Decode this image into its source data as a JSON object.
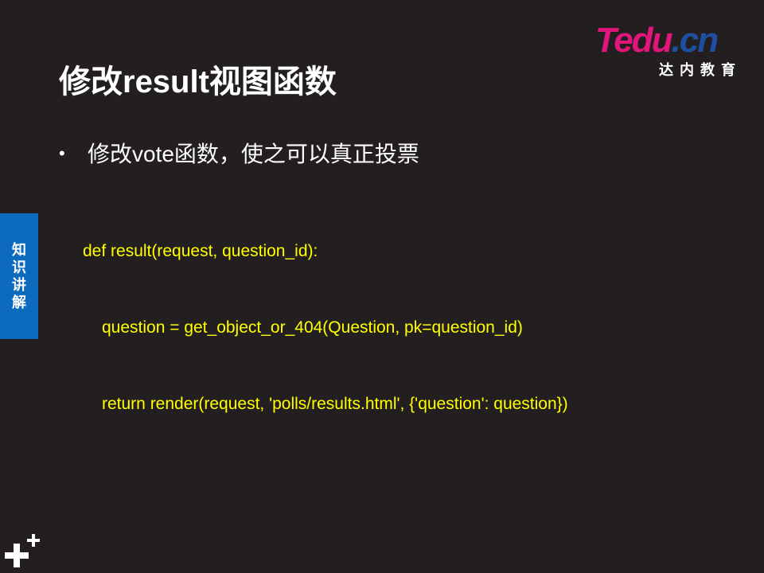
{
  "slide": {
    "title": "修改result视图函数",
    "bullet": "修改vote函数，使之可以真正投票",
    "code_lines": [
      "def result(request, question_id):",
      "question = get_object_or_404(Question, pk=question_id)",
      "return render(request, 'polls/results.html', {'question': question})"
    ]
  },
  "logo": {
    "brand_t": "T",
    "brand_edu": "edu",
    "brand_dot": ".",
    "brand_cn": "cn",
    "subtitle": "达内教育"
  },
  "side_tab": {
    "chars": [
      "知",
      "识",
      "讲",
      "解"
    ]
  },
  "colors": {
    "background": "#231f20",
    "code": "#ffff00",
    "tab": "#0c6bbd",
    "logo_pink": "#e0167b",
    "logo_blue": "#1f4fa0"
  },
  "icons": {
    "bottom_left": "plus-plus-icon"
  }
}
